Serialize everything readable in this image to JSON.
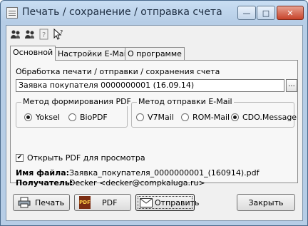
{
  "window": {
    "title": "Печать / сохранение / отправка счета",
    "caption_buttons": {
      "minimize": "—",
      "maximize": "□",
      "close": "✕"
    }
  },
  "toolbar": {
    "icons": [
      "users-up-icon",
      "users-down-icon",
      "help-icon",
      "pointer-help-icon"
    ]
  },
  "tabs": [
    {
      "label": "Основной",
      "active": true
    },
    {
      "label": "Настройки E-Mail",
      "active": false
    },
    {
      "label": "О программе",
      "active": false
    }
  ],
  "main": {
    "section_label": "Обработка печати / отправки / сохранения счета",
    "document_field": "Заявка покупателя 0000000001 (16.09.14)",
    "browse_label": "...",
    "pdf_group": {
      "title": "Метод формирования PDF",
      "options": [
        {
          "label": "Yoksel",
          "selected": true
        },
        {
          "label": "BioPDF",
          "selected": false
        }
      ]
    },
    "email_group": {
      "title": "Метод отправки E-Mail",
      "options": [
        {
          "label": "V7Mail",
          "selected": false
        },
        {
          "label": "ROM-Mail",
          "selected": false
        },
        {
          "label": "CDO.Message",
          "selected": true
        }
      ]
    },
    "open_pdf": {
      "label": "Открыть PDF для просмотра",
      "checked": true
    },
    "file_label": "Имя файла:",
    "file_value": "Заявка_покупателя_0000000001_(160914).pdf",
    "recipient_label": "Получатель:",
    "recipient_value": "Decker <decker@compkaluga.ru>"
  },
  "buttons": {
    "print": "Печать",
    "pdf": "PDF",
    "pdf_icon_text": "PDF",
    "send": "Отправить",
    "close": "Закрыть"
  }
}
